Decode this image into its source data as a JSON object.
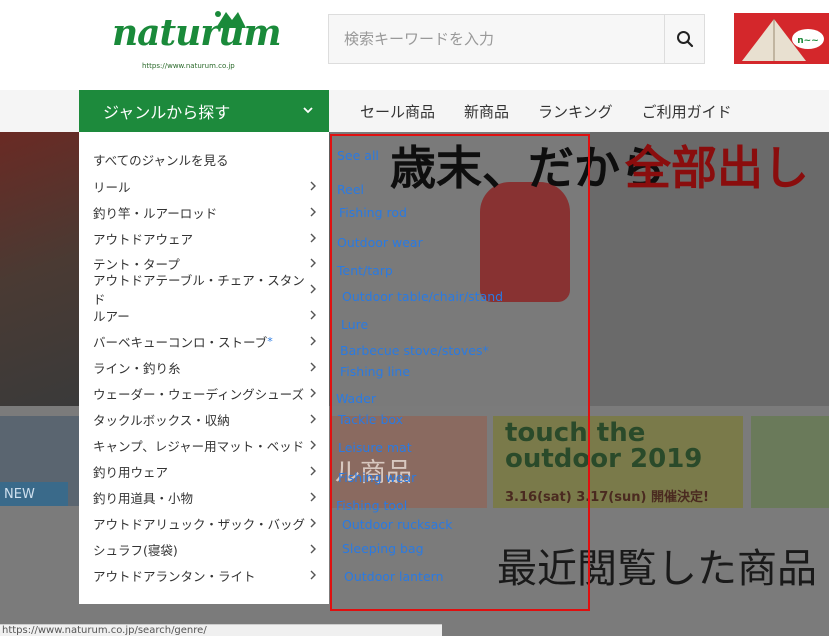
{
  "header": {
    "logo_text": "naturum",
    "logo_url": "https://www.naturum.co.jp",
    "search_placeholder": "検索キーワードを入力"
  },
  "nav": {
    "genre_button": "ジャンルから探す",
    "links": [
      "セール商品",
      "新商品",
      "ランキング",
      "ご利用ガイド"
    ]
  },
  "dropdown": {
    "items": [
      {
        "label": "すべてのジャンルを見る",
        "chevron": false
      },
      {
        "label": "リール",
        "chevron": true
      },
      {
        "label": "釣り竿・ルアーロッド",
        "chevron": true
      },
      {
        "label": "アウトドアウェア",
        "chevron": true
      },
      {
        "label": "テント・タープ",
        "chevron": true
      },
      {
        "label": "アウトドアテーブル・チェア・スタンド",
        "chevron": true
      },
      {
        "label": "ルアー",
        "chevron": true
      },
      {
        "label": "バーベキューコンロ・ストーブ",
        "chevron": true,
        "asterisk": "*"
      },
      {
        "label": "ライン・釣り糸",
        "chevron": true
      },
      {
        "label": "ウェーダー・ウェーディングシューズ",
        "chevron": true
      },
      {
        "label": "タックルボックス・収納",
        "chevron": true
      },
      {
        "label": "キャンプ、レジャー用マット・ベッド",
        "chevron": true
      },
      {
        "label": "釣り用ウェア",
        "chevron": true
      },
      {
        "label": "釣り用道具・小物",
        "chevron": true
      },
      {
        "label": "アウトドアリュック・ザック・バッグ",
        "chevron": true
      },
      {
        "label": "シュラフ(寝袋)",
        "chevron": true
      },
      {
        "label": "アウトドアランタン・ライト",
        "chevron": true
      }
    ]
  },
  "annotations": [
    "See all",
    "Reel",
    "Fishing rod",
    "Outdoor wear",
    "Tent/tarp",
    "Outdoor table/chair/stand",
    "Lure",
    "Barbecue stove/stoves*",
    "Fishing line",
    "Wader",
    "Tackle box",
    "Leisure mat",
    "Fishing wear",
    "Fishing tool",
    "Outdoor rucksack",
    "Sleeping bag",
    "Outdoor lantern"
  ],
  "hero": {
    "title_black": "歳末、だから",
    "title_red": "全部出し"
  },
  "lower": {
    "new_label": "NEW",
    "outdoor_banner_line1": "touch the",
    "outdoor_banner_line2": "outdoor 2019",
    "outdoor_banner_date": "3.16(sat) 3.17(sun) 開催決定!",
    "sale_banner_text": "ル商品",
    "recent_title": "最近閲覧した商品"
  },
  "status_bar": "https://www.naturum.co.jp/search/genre/",
  "colors": {
    "brand_green": "#1d8a3c",
    "annotation_blue": "#2a7ae2",
    "annotation_border": "#e01010"
  }
}
